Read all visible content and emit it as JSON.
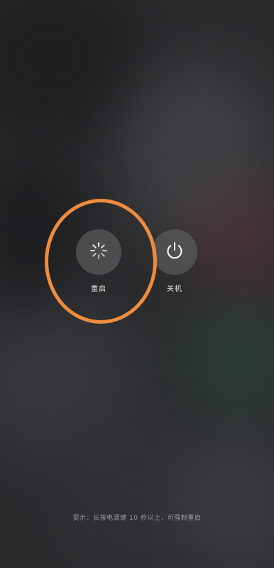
{
  "power_menu": {
    "reboot": {
      "label": "重启",
      "icon": "loading-spinner-icon"
    },
    "shutdown": {
      "label": "关机",
      "icon": "power-icon"
    }
  },
  "hint_text": "提示：长按电源键 10 秒以上，可强制重启",
  "highlight": {
    "color": "#ef8c3d",
    "target": "reboot"
  }
}
